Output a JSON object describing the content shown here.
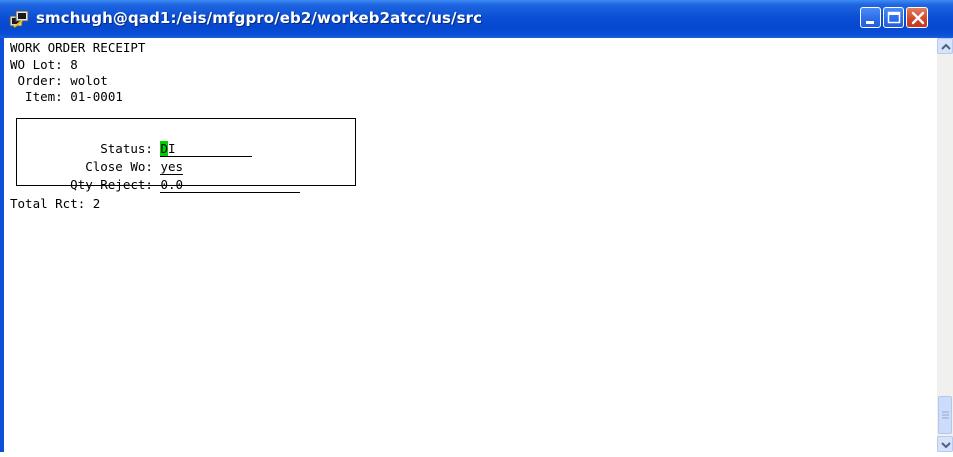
{
  "window": {
    "title": "smchugh@qad1:/eis/mfgpro/eb2/workeb2atcc/us/src",
    "icon": "putty-terminal-icon",
    "controls": [
      "minimize",
      "maximize",
      "close"
    ]
  },
  "screen": {
    "heading": "WORK ORDER RECEIPT",
    "wo_lot": "WO Lot: 8",
    "order": " Order: wolot",
    "item": "  Item: 01-0001",
    "total_rct": "Total Rct: 2"
  },
  "frame": {
    "status": {
      "label": "    Status: ",
      "cursor_char": "D",
      "value": "I"
    },
    "close_wo": {
      "label": "  Close Wo: ",
      "value": "yes"
    },
    "qty_reject": {
      "label": "Qty Reject: ",
      "value": "0.0"
    }
  },
  "colors": {
    "titlebar": "#0a4fd6",
    "cursor": "#00d000",
    "close_button": "#d1462a"
  }
}
